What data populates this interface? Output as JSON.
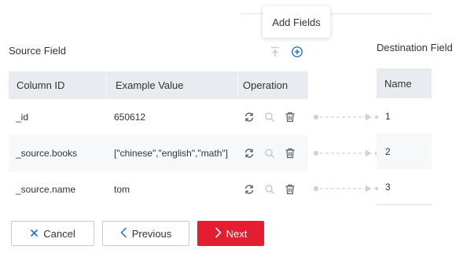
{
  "tooltip": {
    "text": "Add Fields"
  },
  "source": {
    "title": "Source Field",
    "columns": [
      "Column ID",
      "Example Value",
      "Operation"
    ],
    "rows": [
      {
        "column_id": "_id",
        "example_value": "650612"
      },
      {
        "column_id": "_source.books",
        "example_value": "[\"chinese\",\"english\",\"math\"]"
      },
      {
        "column_id": "_source.name",
        "example_value": "tom"
      }
    ],
    "icons": {
      "move_top": "move-to-top-icon",
      "add": "plus-circle-icon",
      "exchange": "exchange-icon",
      "search": "search-icon",
      "delete": "trash-icon"
    }
  },
  "destination": {
    "title": "Destination Field",
    "header": "Name",
    "rows": [
      "1",
      "2",
      "3"
    ]
  },
  "buttons": {
    "cancel": "Cancel",
    "previous": "Previous",
    "next": "Next"
  },
  "colors": {
    "accent": "#e41e30",
    "link": "#1f6fe0",
    "header_bg": "#e8ebf0",
    "icon": "#5c6270",
    "icon_disabled": "#c5c8ce"
  }
}
